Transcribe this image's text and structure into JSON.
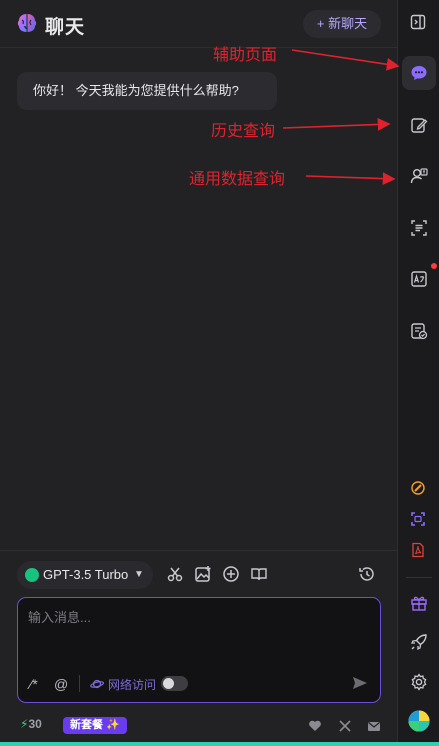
{
  "header": {
    "title": "聊天",
    "new_chat_label": "+ 新聊天"
  },
  "messages": [
    {
      "role": "assistant",
      "text": "你好！ 今天我能为您提供什么帮助?"
    }
  ],
  "toolbar": {
    "model_label": "GPT-3.5 Turbo"
  },
  "input": {
    "placeholder": "输入消息...",
    "value": "",
    "network_label": "网络访问",
    "network_enabled": false
  },
  "bottom": {
    "credits": "30",
    "promo_label": "新套餐 ✨"
  },
  "rail": {
    "items": [
      "expand-panel",
      "assistant-chat",
      "edit",
      "user-query",
      "scan-text",
      "image-translate",
      "document-check",
      "paint",
      "screenshot",
      "pdf",
      "gift",
      "rocket",
      "settings",
      "avatar"
    ]
  },
  "annotations": [
    "辅助页面",
    "历史查询",
    "通用数据查询"
  ],
  "colors": {
    "accent": "#7c5cff",
    "border_input": "#6a4fd8",
    "annotation": "#e0222e",
    "credit_bolt": "#31d38a",
    "notification": "#ff3b3b"
  }
}
